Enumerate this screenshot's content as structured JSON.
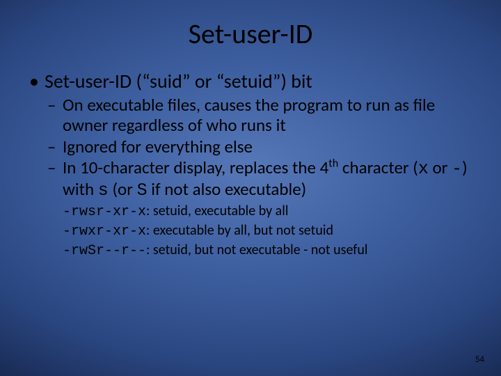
{
  "title": "Set-user-ID",
  "b1": "Set-user-ID (“suid” or “setuid”) bit",
  "b1a": "On executable files, causes the program to run as file owner regardless of who runs it",
  "b1b": "Ignored for everything else",
  "b1c_pre": "In 10-character display, replaces the 4",
  "b1c_sup": "th",
  "b1c_mid": " character (",
  "b1c_x": "x",
  "b1c_or": " or ",
  "b1c_dash": "-",
  "b1c_with": ") with ",
  "b1c_s": "s",
  "b1c_orS": " (or ",
  "b1c_S": "S",
  "b1c_end": " if not also executable)",
  "ex1_code": "-rwsr-xr-x",
  "ex1_desc": ": setuid, executable by all",
  "ex2_code": "-rwxr-xr-x",
  "ex2_desc": ": executable by all, but not setuid",
  "ex3_code": "-rw​Sr--r--",
  "ex3_desc": ": setuid, but not executable - not useful",
  "pagenum": "54"
}
